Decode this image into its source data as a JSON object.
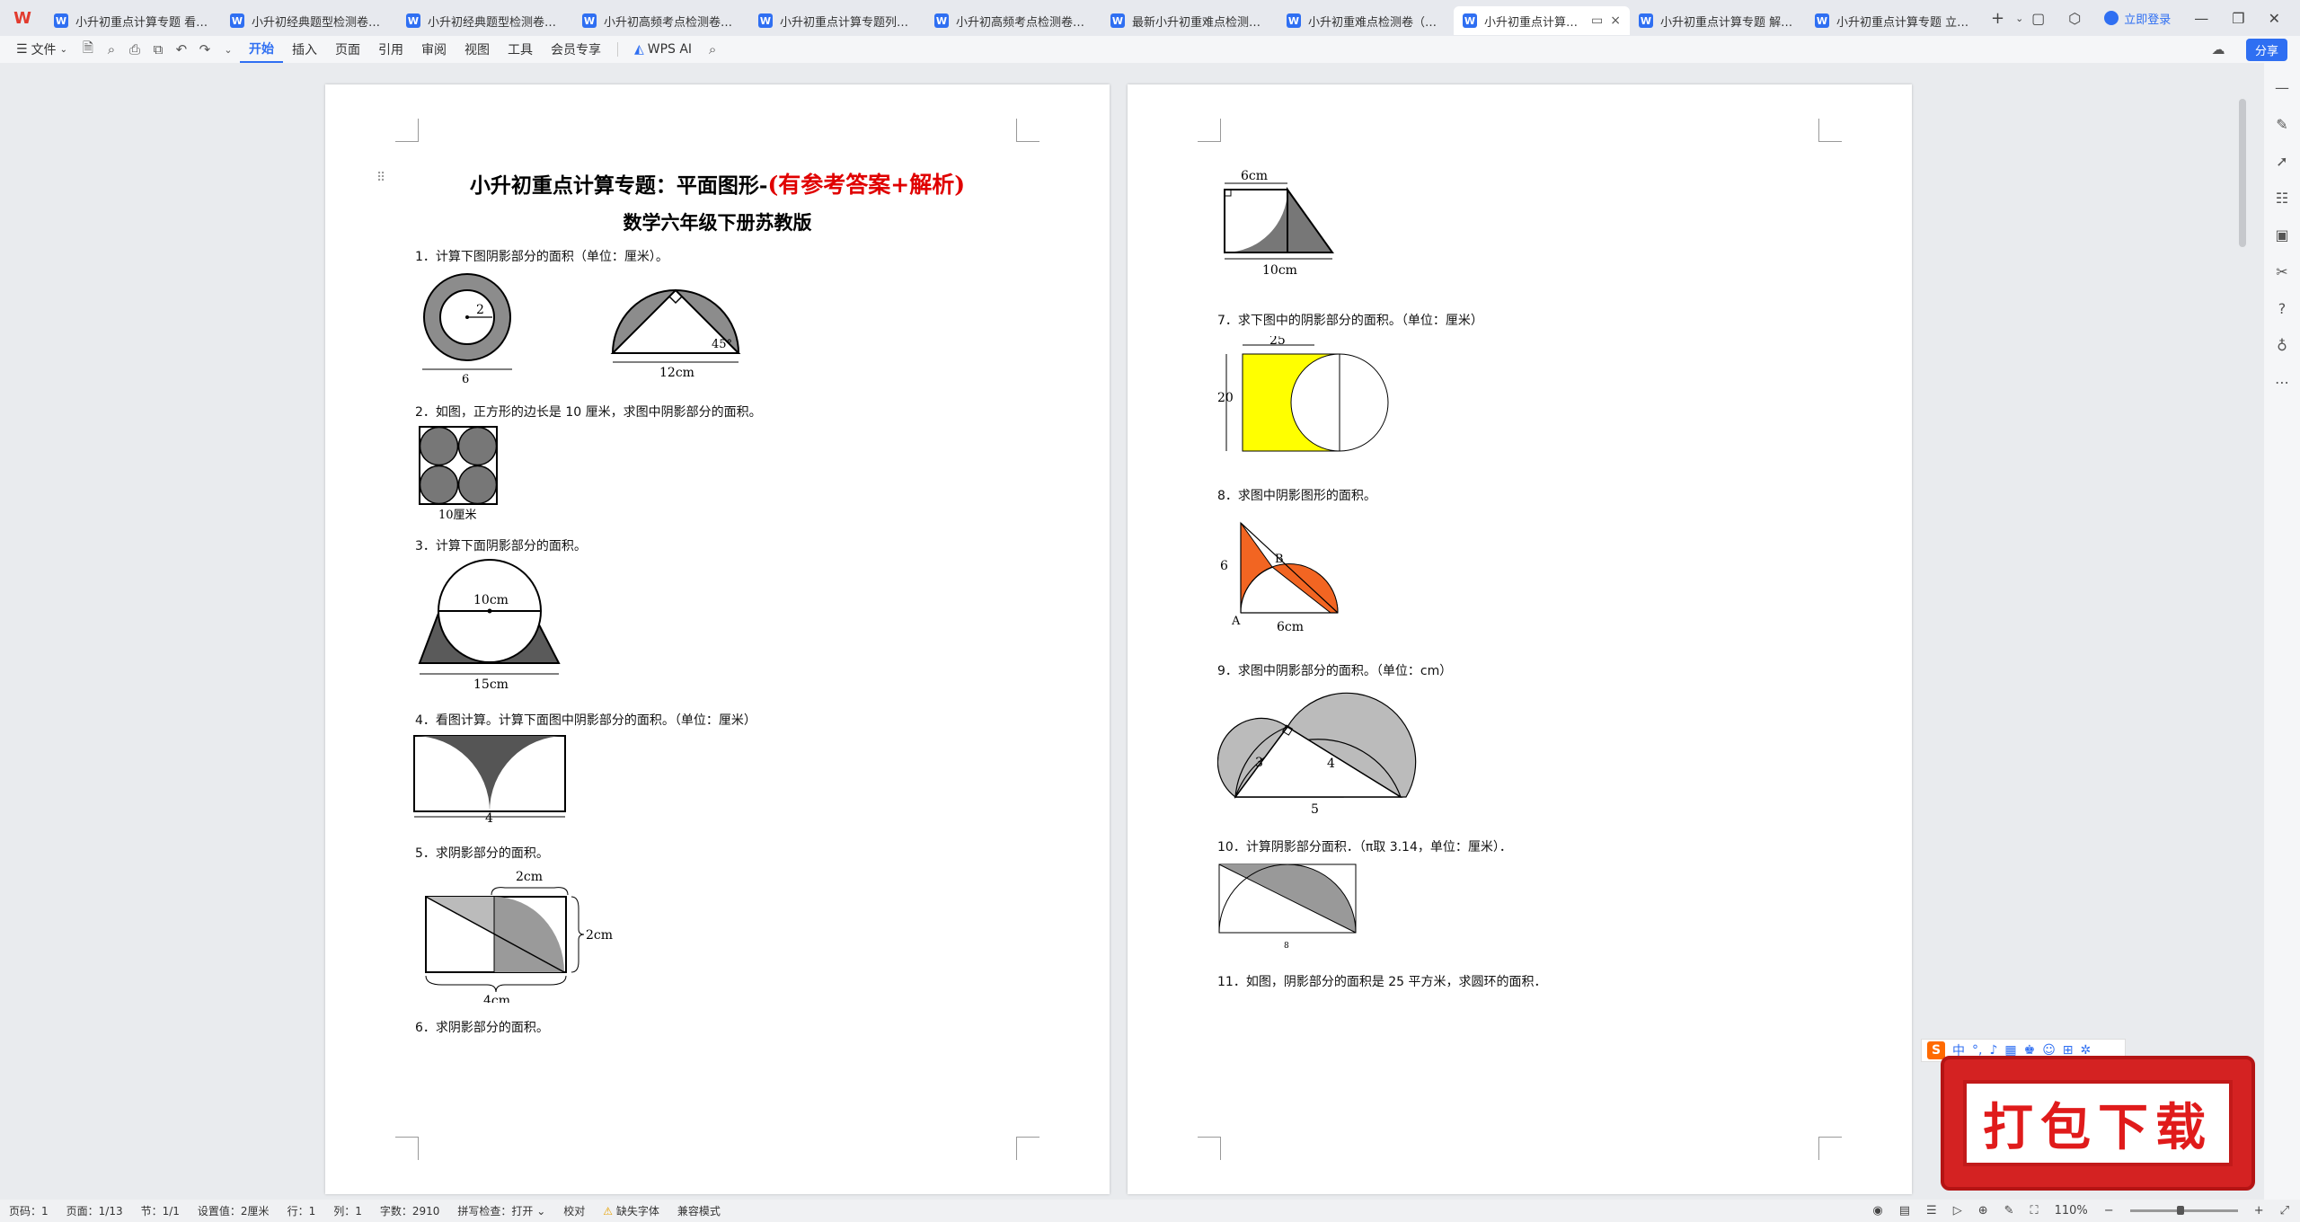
{
  "tabbar": {
    "tabs": [
      {
        "label": "小升初重点计算专题 看图列"
      },
      {
        "label": "小升初经典题型检测卷（一）"
      },
      {
        "label": "小升初经典题型检测卷（二）"
      },
      {
        "label": "小升初高频考点检测卷（一）"
      },
      {
        "label": "小升初重点计算专题列式计"
      },
      {
        "label": "小升初高频考点检测卷二（"
      },
      {
        "label": "最新小升初重难点检测卷（"
      },
      {
        "label": "小升初重难点检测卷（二合"
      },
      {
        "label": "小升初重点计算专题"
      },
      {
        "label": "小升初重点计算专题 解方程"
      },
      {
        "label": "小升初重点计算专题 立体图"
      }
    ],
    "login_label": "立即登录"
  },
  "ribbon": {
    "file_label": "文件",
    "tabs": [
      "开始",
      "插入",
      "页面",
      "引用",
      "审阅",
      "视图",
      "工具",
      "会员专享"
    ],
    "wps_ai_label": "WPS AI",
    "share_label": "分享"
  },
  "doc": {
    "title_main": "小升初重点计算专题：平面图形-",
    "title_red": "(有参考答案+解析)",
    "subtitle": "数学六年级下册苏教版",
    "q1": "1．计算下图阴影部分的面积（单位：厘米）。",
    "q2": "2．如图，正方形的边长是 10 厘米，求图中阴影部分的面积。",
    "q3": "3．计算下面阴影部分的面积。",
    "q4": "4．看图计算。计算下面图中阴影部分的面积。（单位：厘米）",
    "q5": "5．求阴影部分的面积。",
    "q6": "6．求阴影部分的面积。",
    "q7": "7．求下图中的阴影部分的面积。（单位：厘米）",
    "q8": "8．求图中阴影图形的面积。",
    "q9": "9．求图中阴影部分的面积。（单位：cm）",
    "q10": "10．计算阴影部分面积．（π取 3.14，单位：厘米）．",
    "q11": "11．如图，阴影部分的面积是 25 平方米，求圆环的面积．",
    "fig_labels": {
      "f1a_r": "2",
      "f1a_d": "6",
      "f1b_angle": "45°",
      "f1b_len": "12cm",
      "f2_len": "10厘米",
      "f3_top": "10cm",
      "f3_bottom": "15cm",
      "f4_len": "4",
      "f5_top": "2cm",
      "f5_right": "2cm",
      "f5_bottom": "4cm",
      "f6_top": "6cm",
      "f6_bottom": "10cm",
      "f7_w": "25",
      "f7_h": "20",
      "f8_h": "6",
      "f8_b": "B",
      "f8_a": "A",
      "f8_w": "6cm",
      "f9_a": "3",
      "f9_b": "4",
      "f9_c": "5",
      "f10_w": "8"
    }
  },
  "statusbar": {
    "page_num": "页码：1",
    "pages": "页面：1/13",
    "section": "节：1/1",
    "setting": "设置值：2厘米",
    "row": "行：1",
    "col": "列：1",
    "words": "字数：2910",
    "spell": "拼写检查：打开",
    "proof": "校对",
    "missing_font": "缺失字体",
    "compat": "兼容模式",
    "zoom": "110%"
  },
  "ime": {
    "cn": "中"
  },
  "banner": {
    "text": "打包下载"
  },
  "colors": {
    "accent": "#2f6ff2",
    "shade": "#7f7f7f",
    "yellow": "#ffff00",
    "orange": "#f26522",
    "red": "#e00000"
  }
}
